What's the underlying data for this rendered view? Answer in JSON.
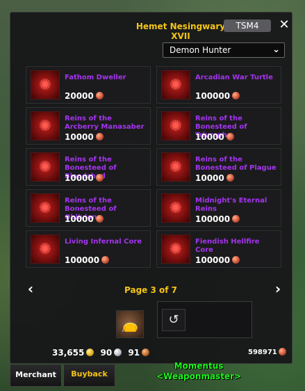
{
  "vendor": {
    "title": "Hemet Nesingwary XVII",
    "addon_badge": "TSM4",
    "close_glyph": "✕"
  },
  "class_filter": {
    "selected": "Demon Hunter"
  },
  "items": [
    {
      "name": "Fathom Dweller",
      "price": "20000",
      "icon": "mount-icon"
    },
    {
      "name": "Arcadian War Turtle",
      "price": "100000",
      "icon": "mount-icon"
    },
    {
      "name": "Reins of the Arcberry Manasaber",
      "price": "10000",
      "icon": "mount-icon"
    },
    {
      "name": "Reins of the Bonesteed of Triumph",
      "price": "10000",
      "icon": "mount-icon"
    },
    {
      "name": "Reins of the Bonesteed of Bloodshed",
      "price": "10000",
      "icon": "mount-icon"
    },
    {
      "name": "Reins of the Bonesteed of Plague",
      "price": "10000",
      "icon": "mount-icon"
    },
    {
      "name": "Reins of the Bonesteed of Oblivion",
      "price": "10000",
      "icon": "mount-icon"
    },
    {
      "name": "Midnight's Eternal Reins",
      "price": "100000",
      "icon": "mount-icon"
    },
    {
      "name": "Living Infernal Core",
      "price": "100000",
      "icon": "mount-icon"
    },
    {
      "name": "Fiendish Hellfire Core",
      "price": "100000",
      "icon": "mount-icon"
    }
  ],
  "pagination": {
    "label": "Page 3 of 7",
    "current": 3,
    "total": 7
  },
  "money": {
    "gold": "33,655",
    "silver": "90",
    "copper": "91"
  },
  "currency_total": "598971",
  "tabs": {
    "merchant": "Merchant",
    "buyback": "Buyback"
  },
  "nameplate": {
    "name": "Momentus",
    "title": "<Weaponmaster>"
  },
  "colors": {
    "item_name": "#a335ee",
    "title_gold": "#f5c518",
    "nameplate_green": "#1ff51f"
  }
}
